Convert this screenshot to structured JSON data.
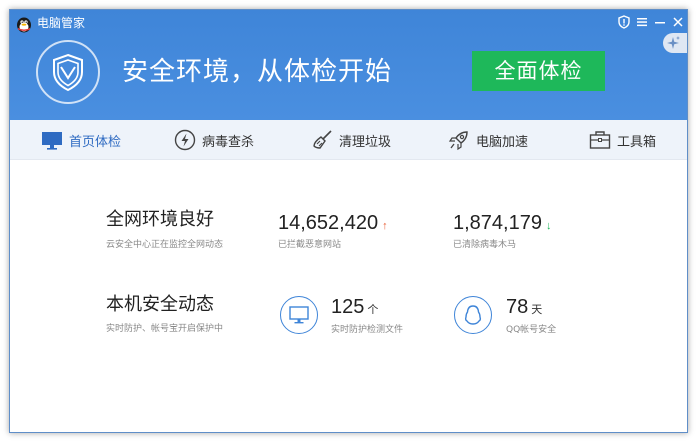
{
  "app": {
    "title": "电脑管家",
    "colors": {
      "header": "#4a8fe0",
      "accent": "#2f6bc2",
      "button_green": "#1eb85a",
      "arrow_up": "#e8623a",
      "arrow_down": "#1eb85a"
    }
  },
  "titlebar": {
    "icons": [
      "shield-info-icon",
      "menu-icon",
      "minimize-icon",
      "close-icon"
    ]
  },
  "header": {
    "slogan": "安全环境，从体检开始",
    "check_button": "全面体检"
  },
  "nav": {
    "items": [
      {
        "label": "首页体检",
        "icon": "monitor-icon"
      },
      {
        "label": "病毒查杀",
        "icon": "lightning-icon"
      },
      {
        "label": "清理垃圾",
        "icon": "broom-icon"
      },
      {
        "label": "电脑加速",
        "icon": "rocket-icon"
      },
      {
        "label": "工具箱",
        "icon": "toolbox-icon"
      }
    ]
  },
  "network": {
    "title": "全网环境良好",
    "subtitle": "云安全中心正在监控全网动态",
    "stats": [
      {
        "value": "14,652,420",
        "arrow": "↑",
        "label": "已拦截恶意网站"
      },
      {
        "value": "1,874,179",
        "arrow": "↓",
        "label": "已清除病毒木马"
      }
    ]
  },
  "local": {
    "title": "本机安全动态",
    "subtitle": "实时防护、帐号宝开启保护中",
    "stats": [
      {
        "value": "125",
        "unit": "个",
        "label": "实时防护检测文件",
        "icon": "monitor-icon"
      },
      {
        "value": "78",
        "unit": "天",
        "label": "QQ帐号安全",
        "icon": "qq-penguin-icon"
      }
    ]
  }
}
